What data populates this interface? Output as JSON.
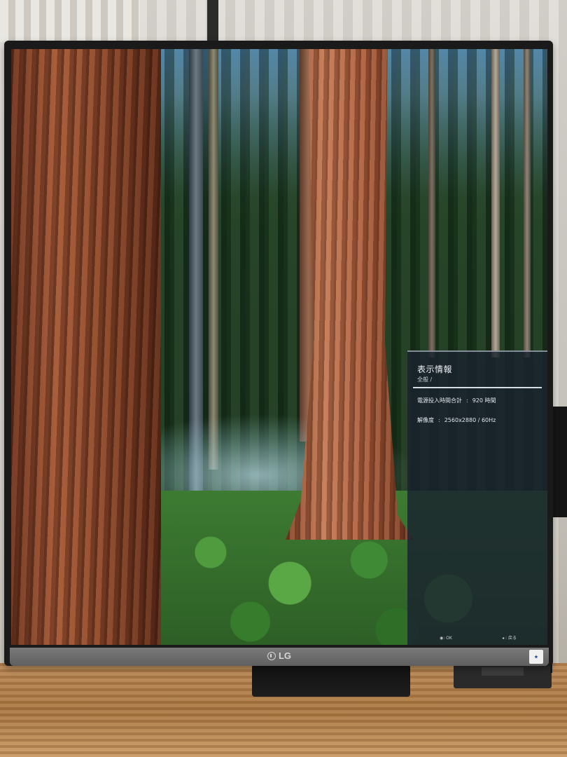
{
  "monitor": {
    "brand": "LG"
  },
  "osd": {
    "title": "表示情報",
    "breadcrumb": "全般  /",
    "rows": [
      {
        "label": "電源投入時間合計",
        "sep": ":",
        "value": "920 時間"
      },
      {
        "label": "解像度",
        "sep": ":",
        "value": "2560x2880  /  60Hz"
      }
    ],
    "footer": {
      "left_icon": "joystick-icon",
      "left": ": OK",
      "right_icon": "back-arrow-icon",
      "right": "◂ : 戻る"
    }
  },
  "colors": {
    "osd_bg": "#1a222e",
    "bezel": "#6b6b6b",
    "desk": "#b98a58"
  }
}
